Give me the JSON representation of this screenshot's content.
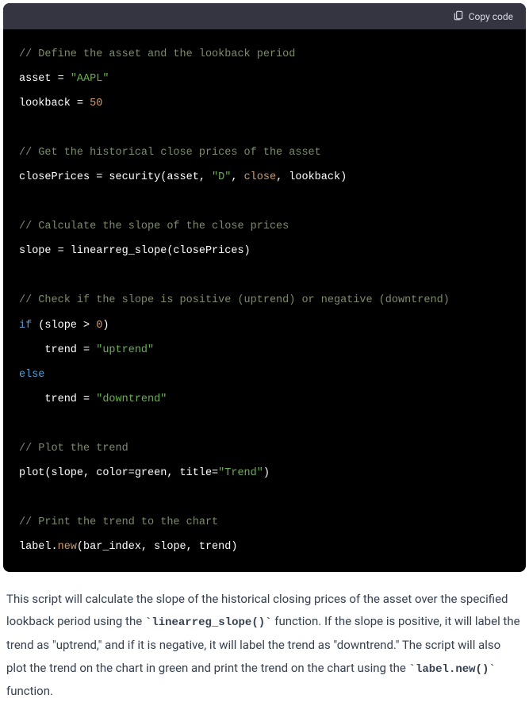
{
  "header": {
    "copy_label": "Copy code"
  },
  "code": {
    "c1": "// Define the asset and the lookback period",
    "l2a": "asset = ",
    "l2b": "\"AAPL\"",
    "l3a": "lookback = ",
    "l3b": "50",
    "c2": "// Get the historical close prices of the asset",
    "l5a": "closePrices = security(asset, ",
    "l5b": "\"D\"",
    "l5c": ", ",
    "l5d": "close",
    "l5e": ", lookback)",
    "c3": "// Calculate the slope of the close prices",
    "l7": "slope = linearreg_slope(closePrices)",
    "c4": "// Check if the slope is positive (uptrend) or negative (downtrend)",
    "l9a": "if",
    "l9b": " (slope > ",
    "l9c": "0",
    "l9d": ")",
    "l10a": "    trend = ",
    "l10b": "\"uptrend\"",
    "l11": "else",
    "l12a": "    trend = ",
    "l12b": "\"downtrend\"",
    "c5": "// Plot the trend",
    "l14a": "plot(slope, color=green, title=",
    "l14b": "\"Trend\"",
    "l14c": ")",
    "c6": "// Print the trend to the chart",
    "l16a": "label.",
    "l16b": "new",
    "l16c": "(bar_index, slope, trend)"
  },
  "desc": {
    "p1a": "This script will calculate the slope of the historical closing prices of the asset over the specified lookback period using the ",
    "p1code1": "`linearreg_slope()`",
    "p1b": " function. If the slope is positive, it will label the trend as \"uptrend,\" and if it is negative, it will label the trend as \"downtrend.\" The script will also plot the trend on the chart in green and print the trend on the chart using the ",
    "p1code2": "`label.new()`",
    "p1c": " function."
  }
}
